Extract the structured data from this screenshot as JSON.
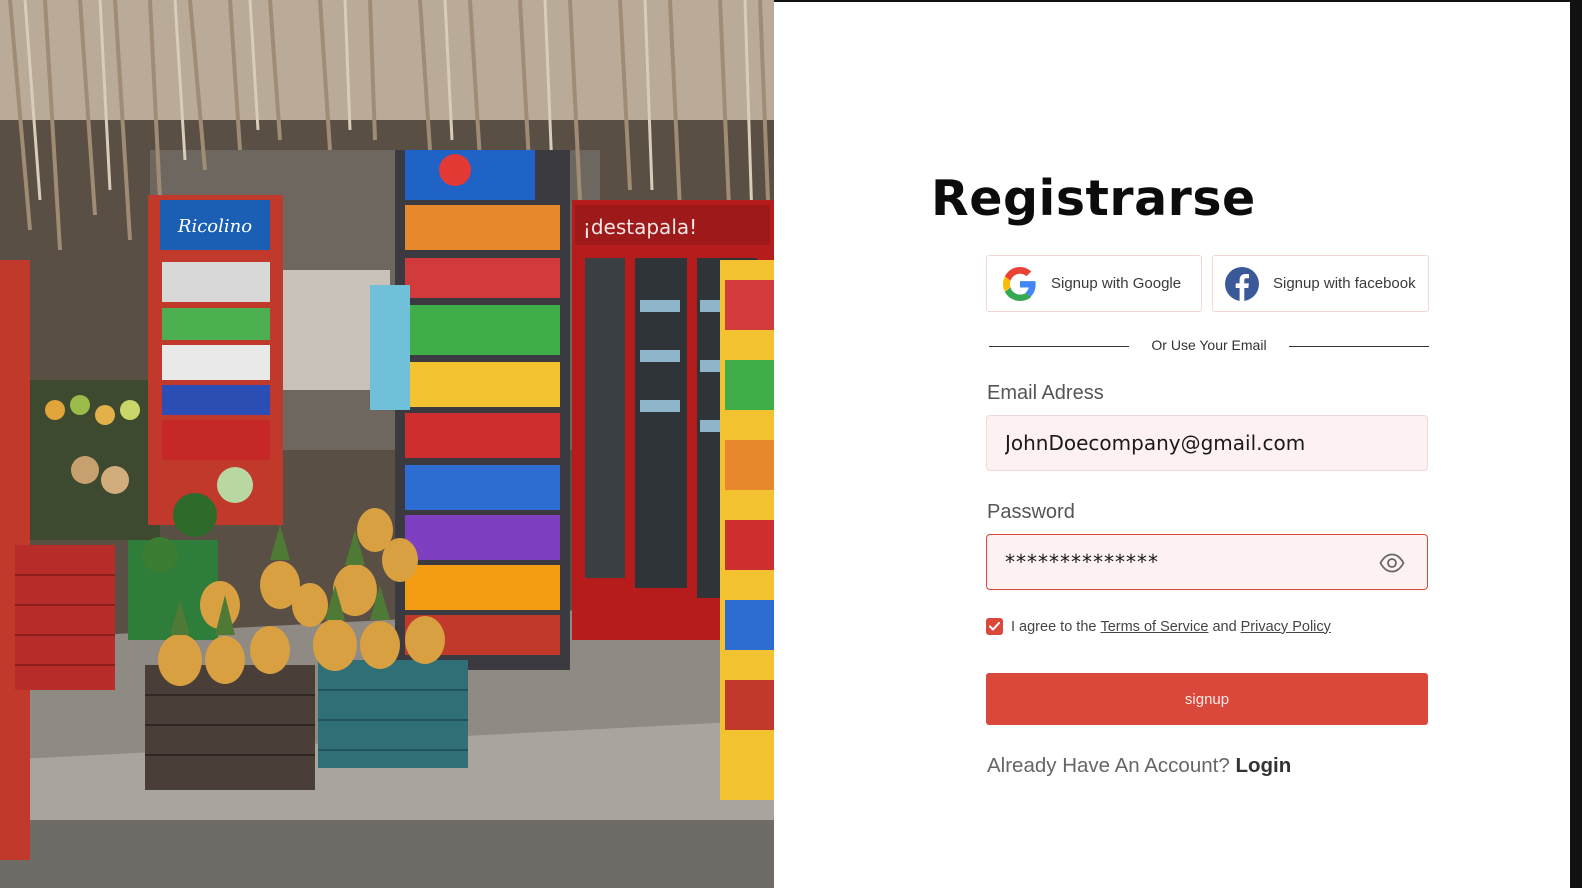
{
  "page": {
    "title": "Registrarse"
  },
  "social": {
    "google_label": "Signup with Google",
    "facebook_label": "Signup with facebook"
  },
  "divider_text": "Or Use Your Email",
  "form": {
    "email_label": "Email Adress",
    "email_value": "JohnDoecompany@gmail.com",
    "password_label": "Password",
    "password_value": "**************",
    "agree_prefix": "I agree to the",
    "terms_link": "Terms of Service",
    "agree_and": "and",
    "privacy_link": "Privacy Policy",
    "agree_checked": true,
    "signup_label": "signup"
  },
  "footer": {
    "prompt": "Already Have An Account?",
    "login_link": "Login"
  },
  "icons": {
    "google": "google-logo-icon",
    "facebook": "facebook-logo-icon",
    "eye": "eye-icon",
    "check": "check-icon"
  },
  "colors": {
    "accent": "#d9483a",
    "input_bg": "#fdf1f1",
    "facebook_blue": "#3b5998"
  }
}
